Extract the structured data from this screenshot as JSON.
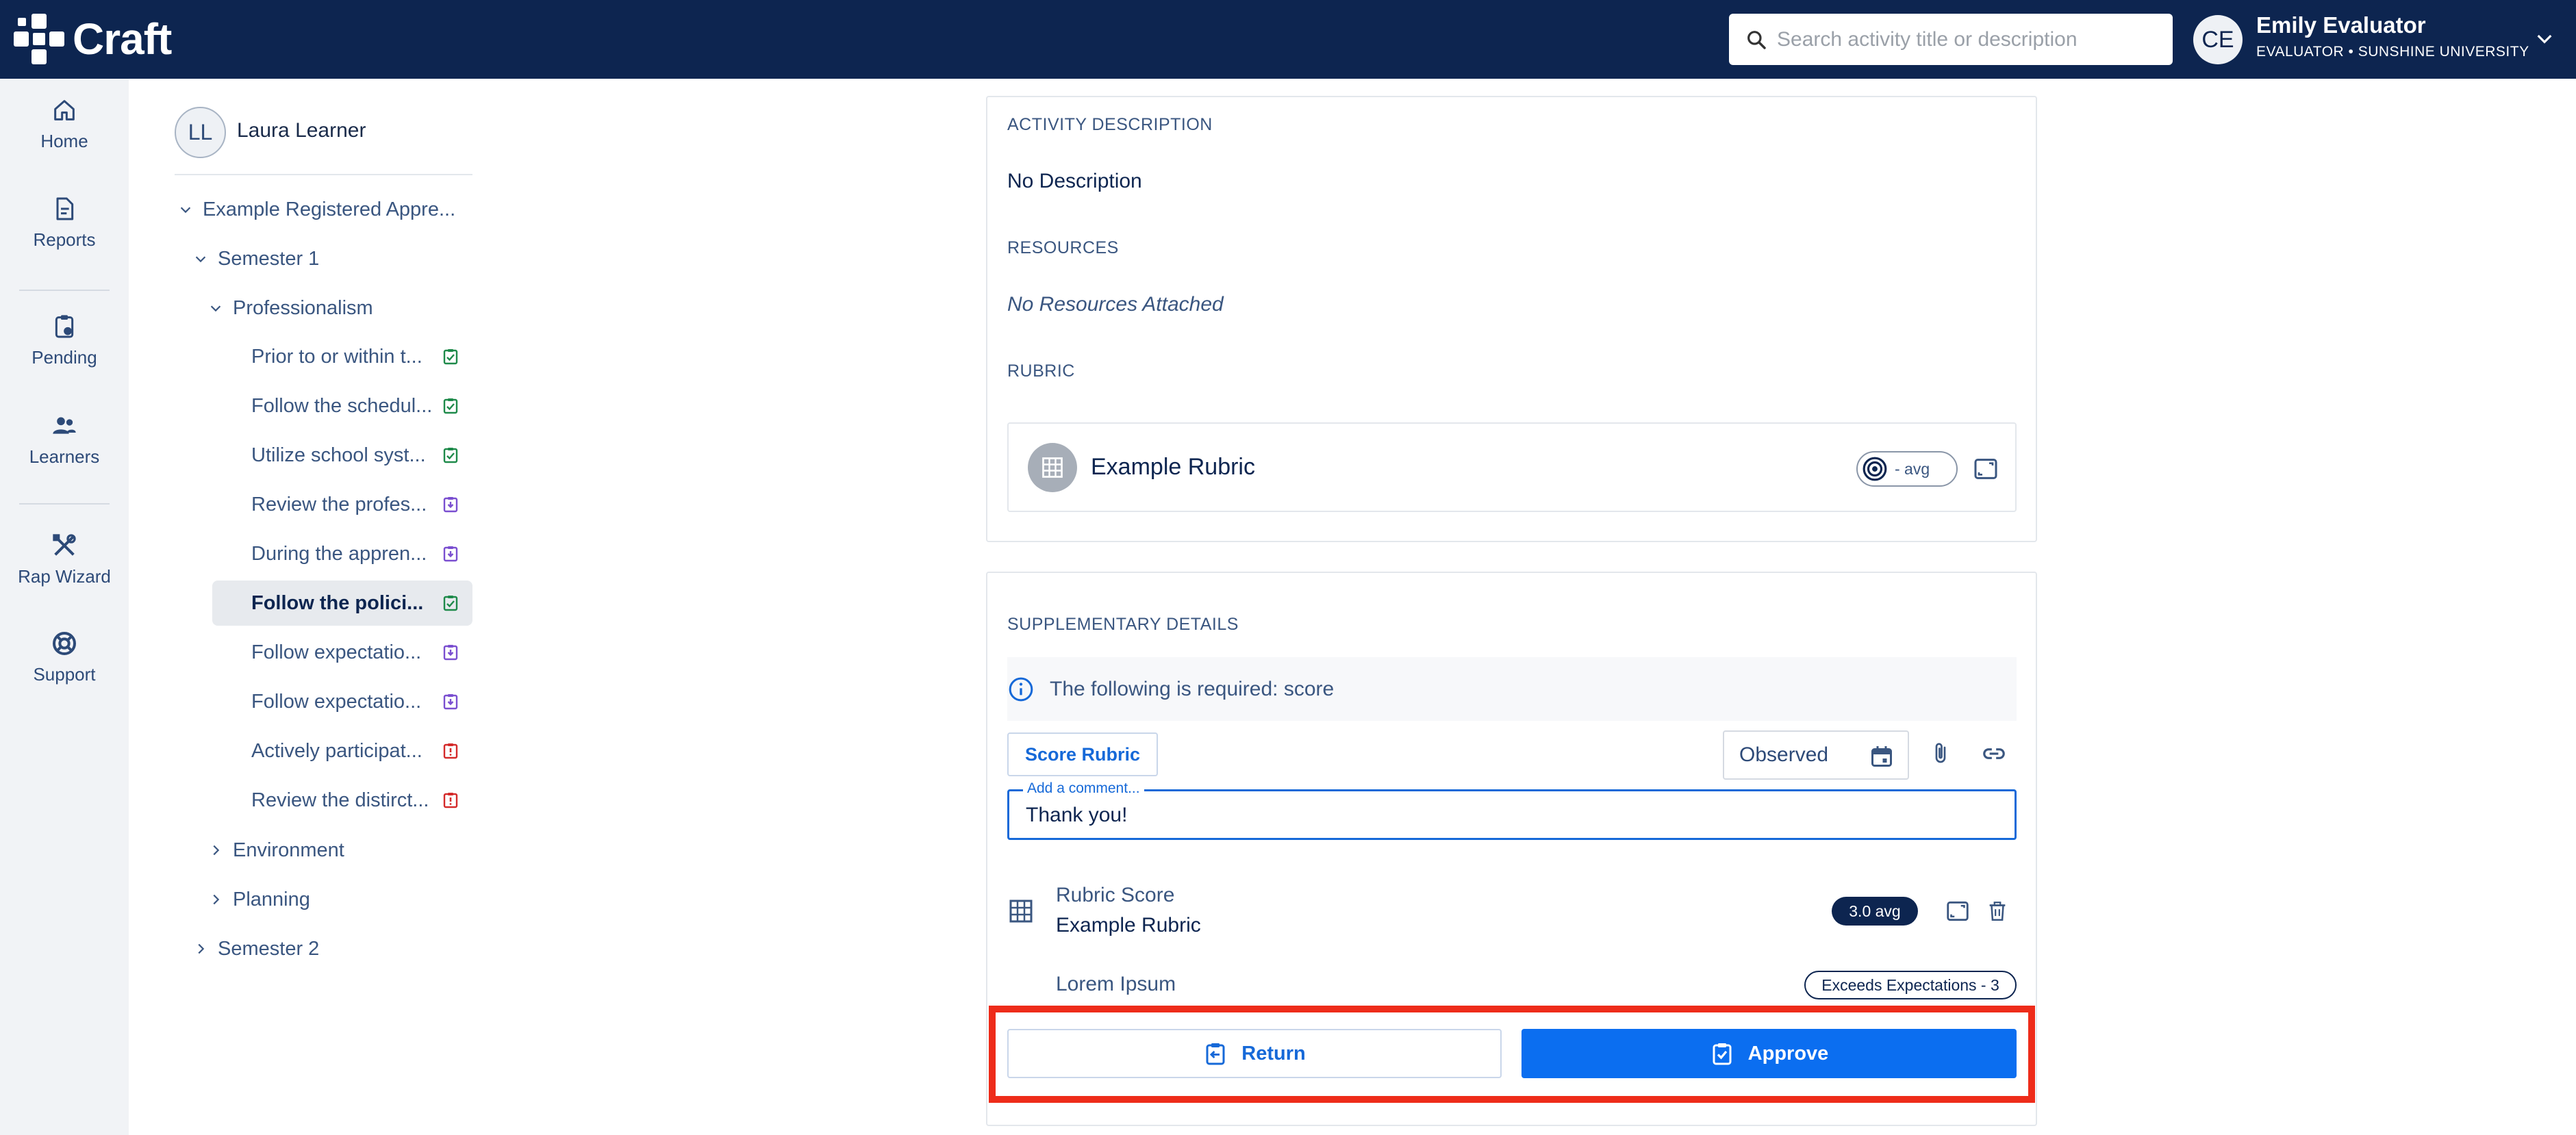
{
  "app": {
    "name": "Craft"
  },
  "search": {
    "placeholder": "Search activity title or description"
  },
  "user": {
    "initials": "CE",
    "name": "Emily Evaluator",
    "role": "EVALUATOR • SUNSHINE UNIVERSITY"
  },
  "nav": {
    "items": [
      {
        "label": "Home",
        "icon": "home-icon"
      },
      {
        "label": "Reports",
        "icon": "reports-icon"
      },
      {
        "label": "Pending",
        "icon": "pending-icon"
      },
      {
        "label": "Learners",
        "icon": "learners-icon"
      },
      {
        "label": "Rap Wizard",
        "icon": "tools-icon"
      },
      {
        "label": "Support",
        "icon": "lifebuoy-icon"
      }
    ]
  },
  "learner": {
    "initials": "LL",
    "name": "Laura Learner"
  },
  "tree": {
    "program": "Example Registered Appre...",
    "semester1": "Semester 1",
    "professionalism": "Professionalism",
    "items": [
      {
        "label": "Prior to or within t...",
        "status": "approved"
      },
      {
        "label": "Follow the schedul...",
        "status": "approved"
      },
      {
        "label": "Utilize school syst...",
        "status": "approved"
      },
      {
        "label": "Review the profes...",
        "status": "pending"
      },
      {
        "label": "During the appren...",
        "status": "pending"
      },
      {
        "label": "Follow the polici...",
        "status": "approved",
        "active": true
      },
      {
        "label": "Follow expectatio...",
        "status": "pending"
      },
      {
        "label": "Follow expectatio...",
        "status": "pending"
      },
      {
        "label": "Actively participat...",
        "status": "returned"
      },
      {
        "label": "Review the distirct...",
        "status": "returned"
      }
    ],
    "environment": "Environment",
    "planning": "Planning",
    "semester2": "Semester 2"
  },
  "activity": {
    "description_label": "ACTIVITY DESCRIPTION",
    "description": "No Description",
    "resources_label": "RESOURCES",
    "resources": "No Resources Attached",
    "rubric_label": "RUBRIC",
    "rubric_name": "Example Rubric",
    "rubric_avg": "- avg"
  },
  "supplementary": {
    "label": "SUPPLEMENTARY DETAILS",
    "info": "The following is required: score",
    "score_button": "Score Rubric",
    "observed": "Observed",
    "comment_label": "Add a comment...",
    "comment_value": "Thank you!",
    "rubric_score_title": "Rubric Score",
    "rubric_score_name": "Example Rubric",
    "rubric_score_avg": "3.0 avg",
    "criterion": "Lorem Ipsum",
    "criterion_score": "Exceeds Expectations - 3"
  },
  "actions": {
    "return_label": "Return",
    "approve_label": "Approve"
  },
  "colors": {
    "header": "#0d2550",
    "accent": "#0b6ef0",
    "approved": "#1e8a4a",
    "pending": "#7a4fd0",
    "returned": "#d42a2a",
    "highlight": "#ee2c1a"
  }
}
